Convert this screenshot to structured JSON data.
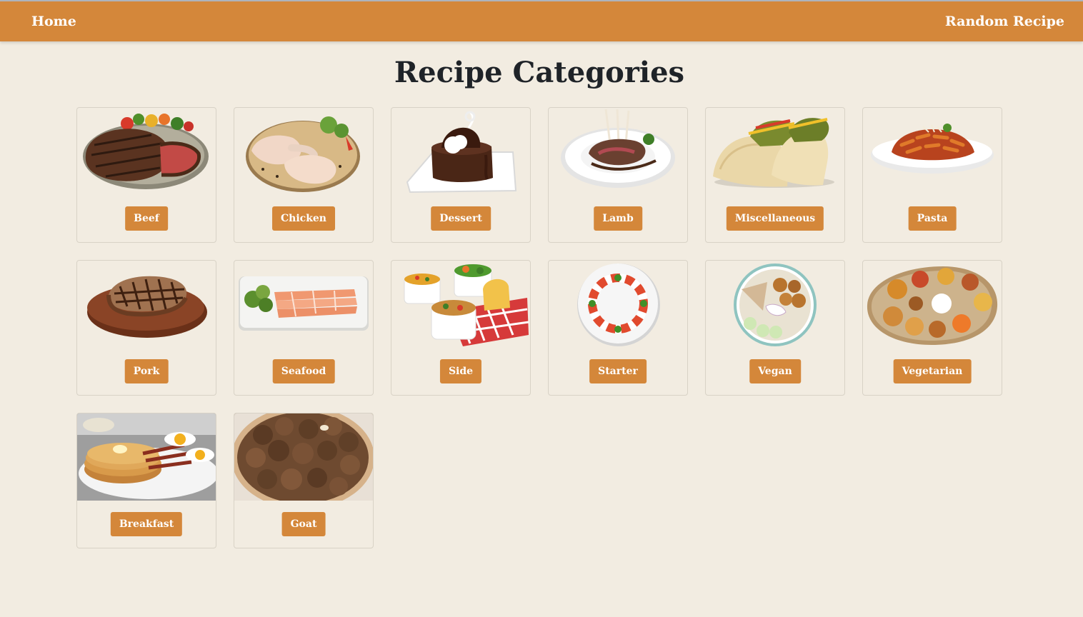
{
  "nav": {
    "home_label": "Home",
    "random_label": "Random Recipe"
  },
  "page": {
    "title": "Recipe Categories"
  },
  "categories": [
    {
      "label": "Beef",
      "icon": "beef-steak-plate-image"
    },
    {
      "label": "Chicken",
      "icon": "chicken-legs-plate-image"
    },
    {
      "label": "Dessert",
      "icon": "chocolate-cake-image"
    },
    {
      "label": "Lamb",
      "icon": "lamb-chops-plate-image"
    },
    {
      "label": "Miscellaneous",
      "icon": "tacos-image"
    },
    {
      "label": "Pasta",
      "icon": "penne-pasta-bowl-image"
    },
    {
      "label": "Pork",
      "icon": "pork-chop-board-image"
    },
    {
      "label": "Seafood",
      "icon": "salmon-platter-image"
    },
    {
      "label": "Side",
      "icon": "side-dishes-image"
    },
    {
      "label": "Starter",
      "icon": "caprese-salad-image"
    },
    {
      "label": "Vegan",
      "icon": "vegan-bowl-image"
    },
    {
      "label": "Vegetarian",
      "icon": "vegetarian-thali-image"
    },
    {
      "label": "Breakfast",
      "icon": "pancakes-breakfast-image"
    },
    {
      "label": "Goat",
      "icon": "goat-meat-image"
    }
  ],
  "colors": {
    "accent": "#d4873a",
    "background": "#f2ece1",
    "title": "#1f2328",
    "button_text": "#ffffff"
  }
}
